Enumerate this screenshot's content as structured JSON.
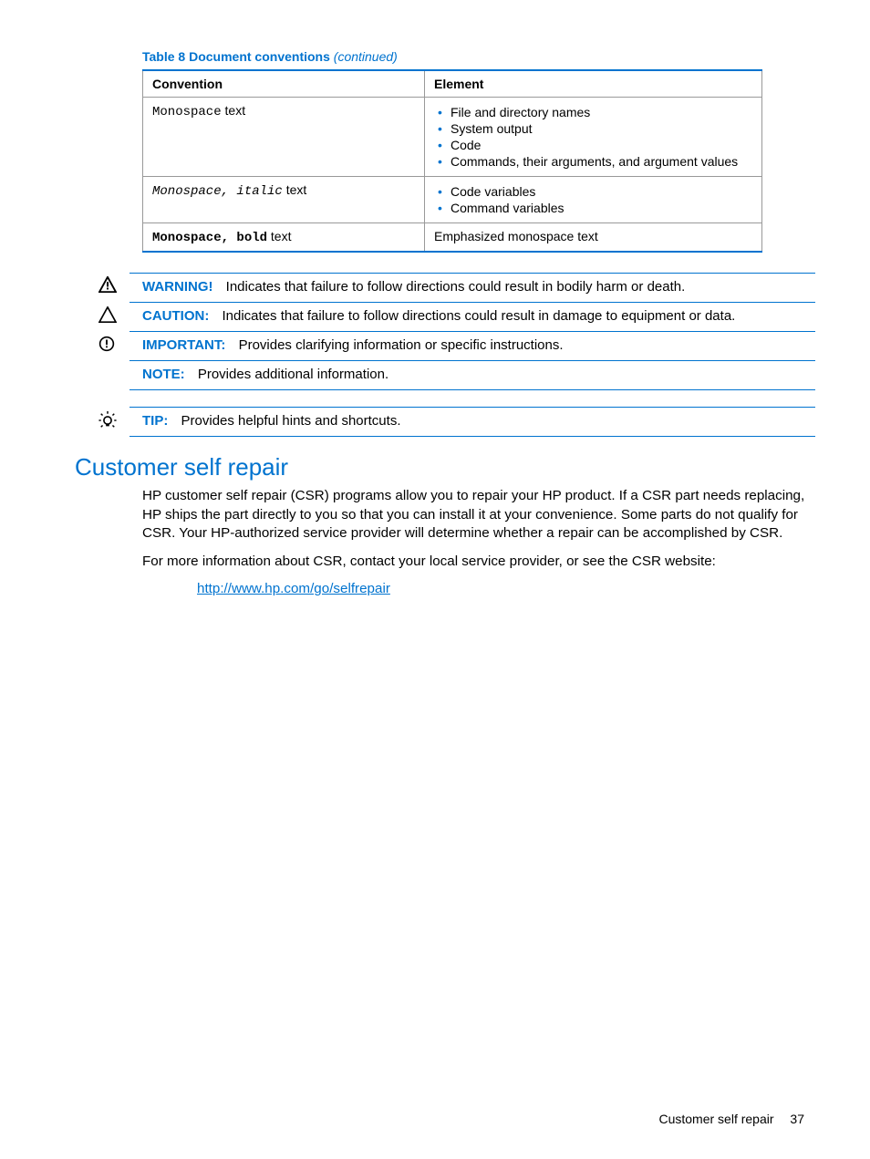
{
  "table": {
    "title_bold": "Table 8 Document conventions",
    "title_italic": "(continued)",
    "headers": {
      "c1": "Convention",
      "c2": "Element"
    },
    "row1": {
      "conv_mono": "Monospace",
      "conv_rest": " text",
      "items": {
        "i1": "File and directory names",
        "i2": "System output",
        "i3": "Code",
        "i4": "Commands, their arguments, and argument values"
      }
    },
    "row2": {
      "conv_mono": "Monospace, italic",
      "conv_rest": " text",
      "items": {
        "i1": "Code variables",
        "i2": "Command variables"
      }
    },
    "row3": {
      "conv_mono": "Monospace, bold",
      "conv_rest": " text",
      "elem": "Emphasized monospace text"
    }
  },
  "admon": {
    "warning": {
      "label": "WARNING!",
      "text": "Indicates that failure to follow directions could result in bodily harm or death."
    },
    "caution": {
      "label": "CAUTION:",
      "text": "Indicates that failure to follow directions could result in damage to equipment or data."
    },
    "important": {
      "label": "IMPORTANT:",
      "text": "Provides clarifying information or specific instructions."
    },
    "note": {
      "label": "NOTE:",
      "text": "Provides additional information."
    },
    "tip": {
      "label": "TIP:",
      "text": "Provides helpful hints and shortcuts."
    }
  },
  "section": {
    "title": "Customer self repair",
    "p1": "HP customer self repair (CSR) programs allow you to repair your HP product. If a CSR part needs replacing, HP ships the part directly to you so that you can install it at your convenience. Some parts do not qualify for CSR. Your HP-authorized service provider will determine whether a repair can be accomplished by CSR.",
    "p2": "For more information about CSR, contact your local service provider, or see the CSR website:",
    "link": "http://www.hp.com/go/selfrepair"
  },
  "footer": {
    "text": "Customer self repair",
    "page": "37"
  }
}
